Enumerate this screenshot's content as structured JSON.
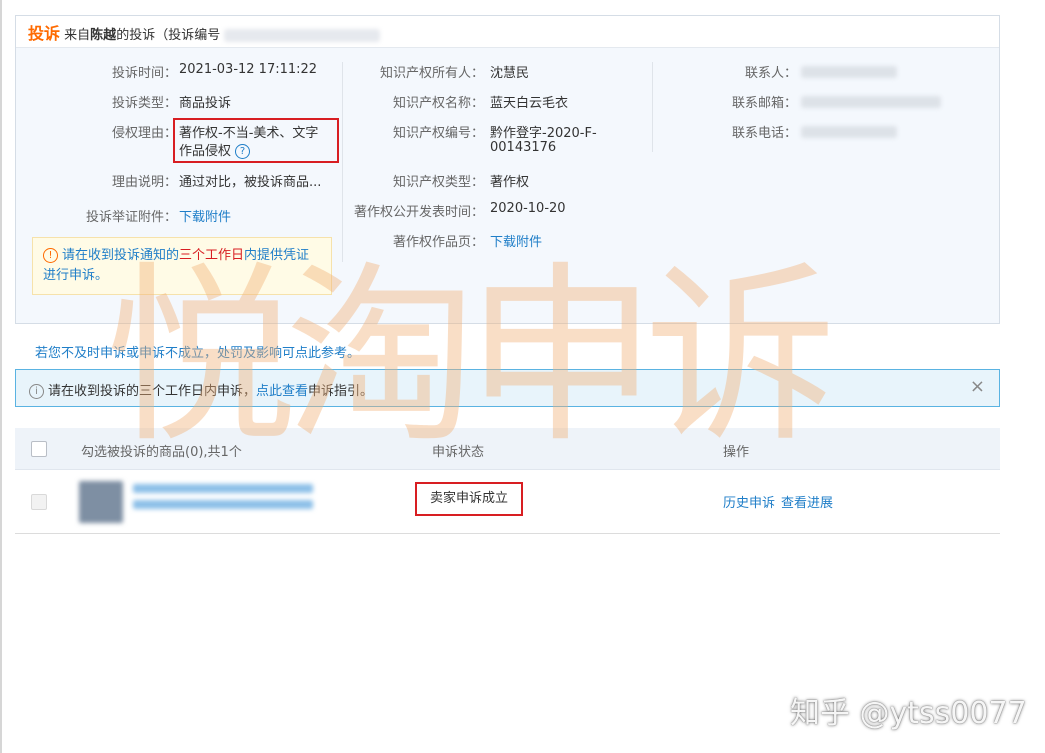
{
  "header": {
    "title": "投诉",
    "from_text": "来自",
    "complainant": "陈越",
    "suffix_text": "的投诉（投诉编号"
  },
  "complaint": {
    "time_label": "投诉时间：",
    "time_value": "2021-03-12 17:11:22",
    "type_label": "投诉类型：",
    "type_value": "商品投诉",
    "reason_label": "侵权理由：",
    "reason_value_line1": "著作权-不当-美术、文字",
    "reason_value_line2": "作品侵权",
    "reason_help": "?",
    "explain_label": "理由说明：",
    "explain_value": "通过对比，被投诉商品...",
    "evidence_label": "投诉举证附件：",
    "evidence_link": "下载附件"
  },
  "ip": {
    "owner_label": "知识产权所有人：",
    "owner_value": "沈慧民",
    "name_label": "知识产权名称：",
    "name_value": "蓝天白云毛衣",
    "number_label": "知识产权编号：",
    "number_value_line1": "黔作登字-2020-F-",
    "number_value_line2": "00143176",
    "type_label": "知识产权类型：",
    "type_value": "著作权",
    "publish_label": "著作权公开发表时间：",
    "publish_value": "2020-10-20",
    "work_label": "著作权作品页：",
    "work_link": "下载附件"
  },
  "contact": {
    "person_label": "联系人：",
    "email_label": "联系邮箱：",
    "phone_label": "联系电话："
  },
  "warning": {
    "icon": "!",
    "text_before": "请在收到投诉通知的",
    "text_red": "三个工作日",
    "text_after": "内提供凭证进行申诉。"
  },
  "hint_text": "若您不及时申诉或申诉不成立，处罚及影响可点此参考。",
  "info_bar": {
    "icon": "i",
    "text_before": "请在收到投诉的三个工作日内申诉，",
    "link": "点此查看",
    "text_after": "申诉指引。",
    "close": "×"
  },
  "table": {
    "col_select": "勾选被投诉的商品(0),共1个",
    "col_status": "申诉状态",
    "col_action": "操作",
    "rows": [
      {
        "status": "卖家申诉成立",
        "action_history": "历史申诉",
        "action_progress": "查看进展"
      }
    ]
  },
  "watermarks": {
    "big": "悦淘申诉",
    "small": "知乎 @ytss0077"
  },
  "colors": {
    "accent_orange": "#ff6a00",
    "link_blue": "#1f7ec8",
    "highlight_red": "#d81e22",
    "panel_bg": "#f4f8fd"
  },
  "icons": [
    "help-icon",
    "warning-icon",
    "info-icon",
    "close-icon"
  ]
}
